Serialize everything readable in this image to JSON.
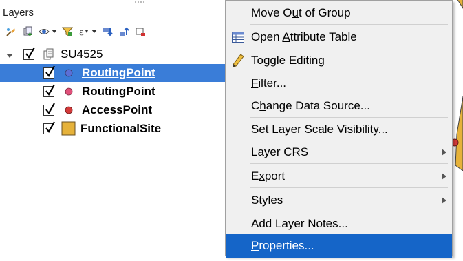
{
  "panel": {
    "title": "Layers",
    "toolbar_icons": [
      "style-manager-icon",
      "add-group-icon",
      "manage-visibility-icon",
      "filter-legend-icon",
      "filter-expression-icon",
      "expand-all-icon",
      "collapse-all-icon",
      "remove-layer-icon"
    ]
  },
  "tree": {
    "group": {
      "label": "SU4525",
      "checked": true,
      "expanded": true
    },
    "layers": [
      {
        "label": "RoutingPoint",
        "checked": true,
        "symbol": "circle",
        "color": "#5b6fd6",
        "selected": true
      },
      {
        "label": "RoutingPoint",
        "checked": true,
        "symbol": "circle",
        "color": "#e0507a",
        "selected": false
      },
      {
        "label": "AccessPoint",
        "checked": true,
        "symbol": "circle",
        "color": "#d43a3a",
        "selected": false
      },
      {
        "label": "FunctionalSite",
        "checked": true,
        "symbol": "square",
        "color": "#e6b23a",
        "selected": false
      }
    ]
  },
  "menu": {
    "items": [
      {
        "pre": "Move O",
        "mn": "u",
        "post": "t of Group"
      },
      {
        "pre": "Open ",
        "mn": "A",
        "post": "ttribute Table",
        "icon": "attribute-table-icon"
      },
      {
        "pre": "Toggle ",
        "mn": "E",
        "post": "diting",
        "icon": "pencil-icon"
      },
      {
        "pre": "",
        "mn": "F",
        "post": "ilter..."
      },
      {
        "pre": "C",
        "mn": "h",
        "post": "ange Data Source..."
      },
      {
        "pre": "Set Layer Scale ",
        "mn": "V",
        "post": "isibility..."
      },
      {
        "pre": "Layer CRS",
        "mn": "",
        "post": ""
      },
      {
        "pre": "E",
        "mn": "x",
        "post": "port"
      },
      {
        "pre": "Styles",
        "mn": "",
        "post": ""
      },
      {
        "pre": "Add Layer Notes...",
        "mn": "",
        "post": ""
      },
      {
        "pre": "",
        "mn": "P",
        "post": "roperties..."
      }
    ]
  },
  "colors": {
    "selection": "#3a7dd8",
    "menu_highlight": "#1565c8",
    "map_polygon": "#e6b23a",
    "map_point": "#d43a3a"
  }
}
